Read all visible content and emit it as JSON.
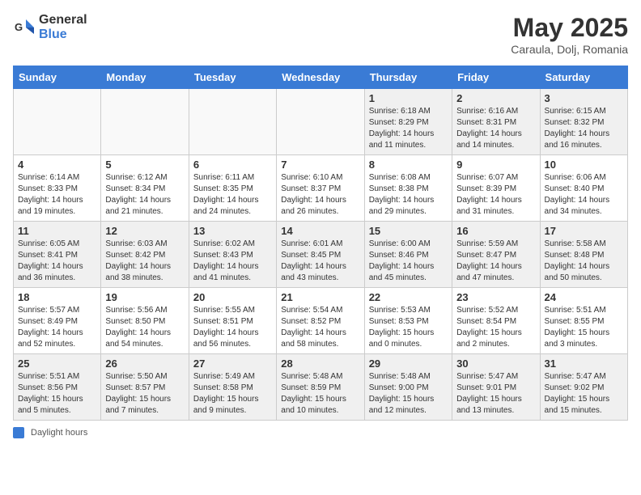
{
  "header": {
    "logo_general": "General",
    "logo_blue": "Blue",
    "month_title": "May 2025",
    "subtitle": "Caraula, Dolj, Romania"
  },
  "days_of_week": [
    "Sunday",
    "Monday",
    "Tuesday",
    "Wednesday",
    "Thursday",
    "Friday",
    "Saturday"
  ],
  "legend": {
    "label": "Daylight hours"
  },
  "weeks": [
    [
      {
        "day": "",
        "info": ""
      },
      {
        "day": "",
        "info": ""
      },
      {
        "day": "",
        "info": ""
      },
      {
        "day": "",
        "info": ""
      },
      {
        "day": "1",
        "info": "Sunrise: 6:18 AM\nSunset: 8:29 PM\nDaylight: 14 hours\nand 11 minutes."
      },
      {
        "day": "2",
        "info": "Sunrise: 6:16 AM\nSunset: 8:31 PM\nDaylight: 14 hours\nand 14 minutes."
      },
      {
        "day": "3",
        "info": "Sunrise: 6:15 AM\nSunset: 8:32 PM\nDaylight: 14 hours\nand 16 minutes."
      }
    ],
    [
      {
        "day": "4",
        "info": "Sunrise: 6:14 AM\nSunset: 8:33 PM\nDaylight: 14 hours\nand 19 minutes."
      },
      {
        "day": "5",
        "info": "Sunrise: 6:12 AM\nSunset: 8:34 PM\nDaylight: 14 hours\nand 21 minutes."
      },
      {
        "day": "6",
        "info": "Sunrise: 6:11 AM\nSunset: 8:35 PM\nDaylight: 14 hours\nand 24 minutes."
      },
      {
        "day": "7",
        "info": "Sunrise: 6:10 AM\nSunset: 8:37 PM\nDaylight: 14 hours\nand 26 minutes."
      },
      {
        "day": "8",
        "info": "Sunrise: 6:08 AM\nSunset: 8:38 PM\nDaylight: 14 hours\nand 29 minutes."
      },
      {
        "day": "9",
        "info": "Sunrise: 6:07 AM\nSunset: 8:39 PM\nDaylight: 14 hours\nand 31 minutes."
      },
      {
        "day": "10",
        "info": "Sunrise: 6:06 AM\nSunset: 8:40 PM\nDaylight: 14 hours\nand 34 minutes."
      }
    ],
    [
      {
        "day": "11",
        "info": "Sunrise: 6:05 AM\nSunset: 8:41 PM\nDaylight: 14 hours\nand 36 minutes."
      },
      {
        "day": "12",
        "info": "Sunrise: 6:03 AM\nSunset: 8:42 PM\nDaylight: 14 hours\nand 38 minutes."
      },
      {
        "day": "13",
        "info": "Sunrise: 6:02 AM\nSunset: 8:43 PM\nDaylight: 14 hours\nand 41 minutes."
      },
      {
        "day": "14",
        "info": "Sunrise: 6:01 AM\nSunset: 8:45 PM\nDaylight: 14 hours\nand 43 minutes."
      },
      {
        "day": "15",
        "info": "Sunrise: 6:00 AM\nSunset: 8:46 PM\nDaylight: 14 hours\nand 45 minutes."
      },
      {
        "day": "16",
        "info": "Sunrise: 5:59 AM\nSunset: 8:47 PM\nDaylight: 14 hours\nand 47 minutes."
      },
      {
        "day": "17",
        "info": "Sunrise: 5:58 AM\nSunset: 8:48 PM\nDaylight: 14 hours\nand 50 minutes."
      }
    ],
    [
      {
        "day": "18",
        "info": "Sunrise: 5:57 AM\nSunset: 8:49 PM\nDaylight: 14 hours\nand 52 minutes."
      },
      {
        "day": "19",
        "info": "Sunrise: 5:56 AM\nSunset: 8:50 PM\nDaylight: 14 hours\nand 54 minutes."
      },
      {
        "day": "20",
        "info": "Sunrise: 5:55 AM\nSunset: 8:51 PM\nDaylight: 14 hours\nand 56 minutes."
      },
      {
        "day": "21",
        "info": "Sunrise: 5:54 AM\nSunset: 8:52 PM\nDaylight: 14 hours\nand 58 minutes."
      },
      {
        "day": "22",
        "info": "Sunrise: 5:53 AM\nSunset: 8:53 PM\nDaylight: 15 hours\nand 0 minutes."
      },
      {
        "day": "23",
        "info": "Sunrise: 5:52 AM\nSunset: 8:54 PM\nDaylight: 15 hours\nand 2 minutes."
      },
      {
        "day": "24",
        "info": "Sunrise: 5:51 AM\nSunset: 8:55 PM\nDaylight: 15 hours\nand 3 minutes."
      }
    ],
    [
      {
        "day": "25",
        "info": "Sunrise: 5:51 AM\nSunset: 8:56 PM\nDaylight: 15 hours\nand 5 minutes."
      },
      {
        "day": "26",
        "info": "Sunrise: 5:50 AM\nSunset: 8:57 PM\nDaylight: 15 hours\nand 7 minutes."
      },
      {
        "day": "27",
        "info": "Sunrise: 5:49 AM\nSunset: 8:58 PM\nDaylight: 15 hours\nand 9 minutes."
      },
      {
        "day": "28",
        "info": "Sunrise: 5:48 AM\nSunset: 8:59 PM\nDaylight: 15 hours\nand 10 minutes."
      },
      {
        "day": "29",
        "info": "Sunrise: 5:48 AM\nSunset: 9:00 PM\nDaylight: 15 hours\nand 12 minutes."
      },
      {
        "day": "30",
        "info": "Sunrise: 5:47 AM\nSunset: 9:01 PM\nDaylight: 15 hours\nand 13 minutes."
      },
      {
        "day": "31",
        "info": "Sunrise: 5:47 AM\nSunset: 9:02 PM\nDaylight: 15 hours\nand 15 minutes."
      }
    ]
  ]
}
